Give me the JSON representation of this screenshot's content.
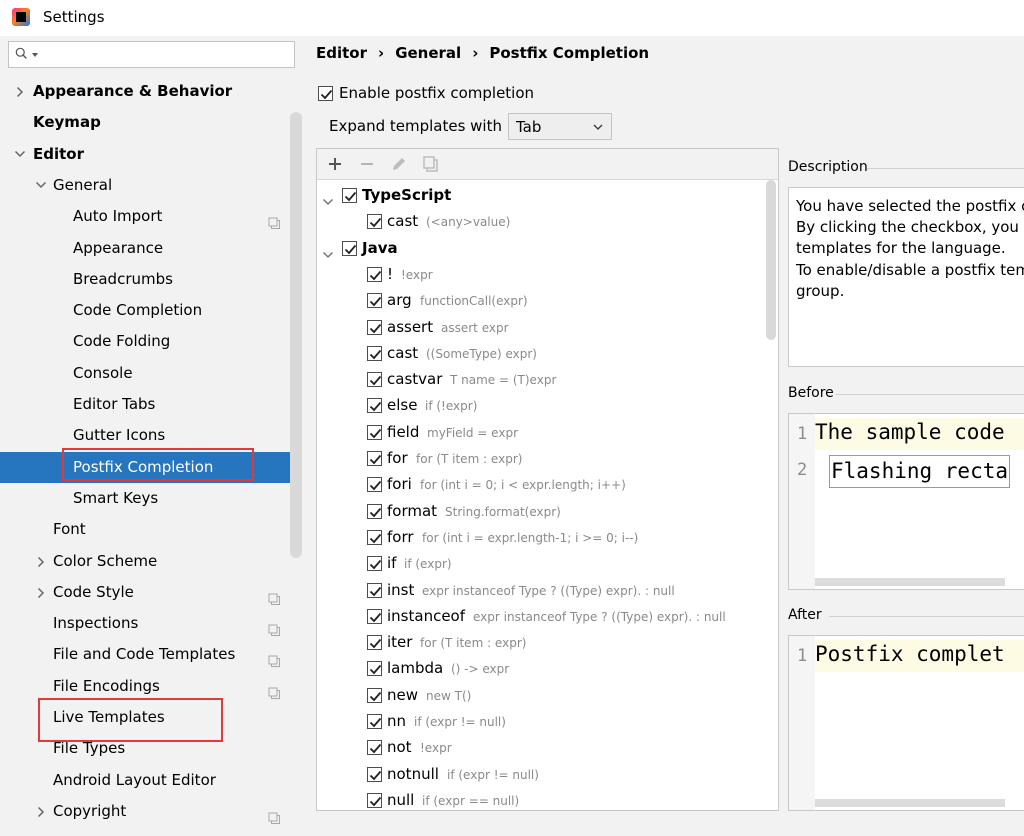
{
  "window": {
    "title": "Settings"
  },
  "search": {
    "placeholder": ""
  },
  "sidebar": {
    "items": [
      {
        "label": "Appearance & Behavior",
        "level": 0,
        "arrow": "right",
        "bold": true
      },
      {
        "label": "Keymap",
        "level": 0,
        "arrow": "none",
        "bold": true
      },
      {
        "label": "Editor",
        "level": 0,
        "arrow": "down",
        "bold": true
      },
      {
        "label": "General",
        "level": 1,
        "arrow": "down"
      },
      {
        "label": "Auto Import",
        "level": 2,
        "icon": true
      },
      {
        "label": "Appearance",
        "level": 2
      },
      {
        "label": "Breadcrumbs",
        "level": 2
      },
      {
        "label": "Code Completion",
        "level": 2
      },
      {
        "label": "Code Folding",
        "level": 2
      },
      {
        "label": "Console",
        "level": 2
      },
      {
        "label": "Editor Tabs",
        "level": 2
      },
      {
        "label": "Gutter Icons",
        "level": 2
      },
      {
        "label": "Postfix Completion",
        "level": 2,
        "selected": true
      },
      {
        "label": "Smart Keys",
        "level": 2
      },
      {
        "label": "Font",
        "level": 1
      },
      {
        "label": "Color Scheme",
        "level": 1,
        "arrow": "right"
      },
      {
        "label": "Code Style",
        "level": 1,
        "arrow": "right",
        "icon": true
      },
      {
        "label": "Inspections",
        "level": 1,
        "icon": true
      },
      {
        "label": "File and Code Templates",
        "level": 1,
        "icon": true
      },
      {
        "label": "File Encodings",
        "level": 1,
        "icon": true
      },
      {
        "label": "Live Templates",
        "level": 1
      },
      {
        "label": "File Types",
        "level": 1
      },
      {
        "label": "Android Layout Editor",
        "level": 1
      },
      {
        "label": "Copyright",
        "level": 1,
        "arrow": "right",
        "icon": true
      }
    ]
  },
  "breadcrumb": [
    "Editor",
    "General",
    "Postfix Completion"
  ],
  "enable_checkbox": {
    "label": "Enable postfix completion",
    "checked": true
  },
  "expand": {
    "label": "Expand templates with",
    "value": "Tab"
  },
  "templates": [
    {
      "name": "TypeScript",
      "group": true,
      "checked": true
    },
    {
      "name": "cast",
      "example": "(<any>value)",
      "checked": true
    },
    {
      "name": "Java",
      "group": true,
      "checked": true
    },
    {
      "name": "!",
      "example": "!expr",
      "checked": true
    },
    {
      "name": "arg",
      "example": "functionCall(expr)",
      "checked": true
    },
    {
      "name": "assert",
      "example": "assert expr",
      "checked": true
    },
    {
      "name": "cast",
      "example": "((SomeType) expr)",
      "checked": true
    },
    {
      "name": "castvar",
      "example": "T name = (T)expr",
      "checked": true
    },
    {
      "name": "else",
      "example": "if (!expr)",
      "checked": true
    },
    {
      "name": "field",
      "example": "myField = expr",
      "checked": true
    },
    {
      "name": "for",
      "example": "for (T item : expr)",
      "checked": true
    },
    {
      "name": "fori",
      "example": "for (int i = 0; i < expr.length; i++)",
      "checked": true
    },
    {
      "name": "format",
      "example": "String.format(expr)",
      "checked": true
    },
    {
      "name": "forr",
      "example": "for (int i = expr.length-1; i >= 0; i--)",
      "checked": true
    },
    {
      "name": "if",
      "example": "if (expr)",
      "checked": true
    },
    {
      "name": "inst",
      "example": "expr instanceof Type ? ((Type) expr). : null",
      "checked": true
    },
    {
      "name": "instanceof",
      "example": "expr instanceof Type ? ((Type) expr). : null",
      "checked": true
    },
    {
      "name": "iter",
      "example": "for (T item : expr)",
      "checked": true
    },
    {
      "name": "lambda",
      "example": "() -> expr",
      "checked": true
    },
    {
      "name": "new",
      "example": "new T()",
      "checked": true
    },
    {
      "name": "nn",
      "example": "if (expr != null)",
      "checked": true
    },
    {
      "name": "not",
      "example": "!expr",
      "checked": true
    },
    {
      "name": "notnull",
      "example": "if (expr != null)",
      "checked": true
    },
    {
      "name": "null",
      "example": "if (expr == null)",
      "checked": true
    }
  ],
  "description": {
    "title": "Description",
    "lines": [
      "You have selected the postfix co",
      "By clicking the checkbox, you ca",
      "templates for the language.",
      "To enable/disable a postfix tem",
      "group."
    ]
  },
  "before": {
    "title": "Before",
    "lines": [
      {
        "num": "1",
        "text": "The sample code"
      },
      {
        "num": "2",
        "text": "Flashing recta"
      }
    ]
  },
  "after": {
    "title": "After",
    "lines": [
      {
        "num": "1",
        "text": "Postfix complet"
      }
    ]
  },
  "colors": {
    "selection": "#2675bf",
    "highlight_box": "#e23a3a",
    "example_text": "#8a8a8a"
  }
}
